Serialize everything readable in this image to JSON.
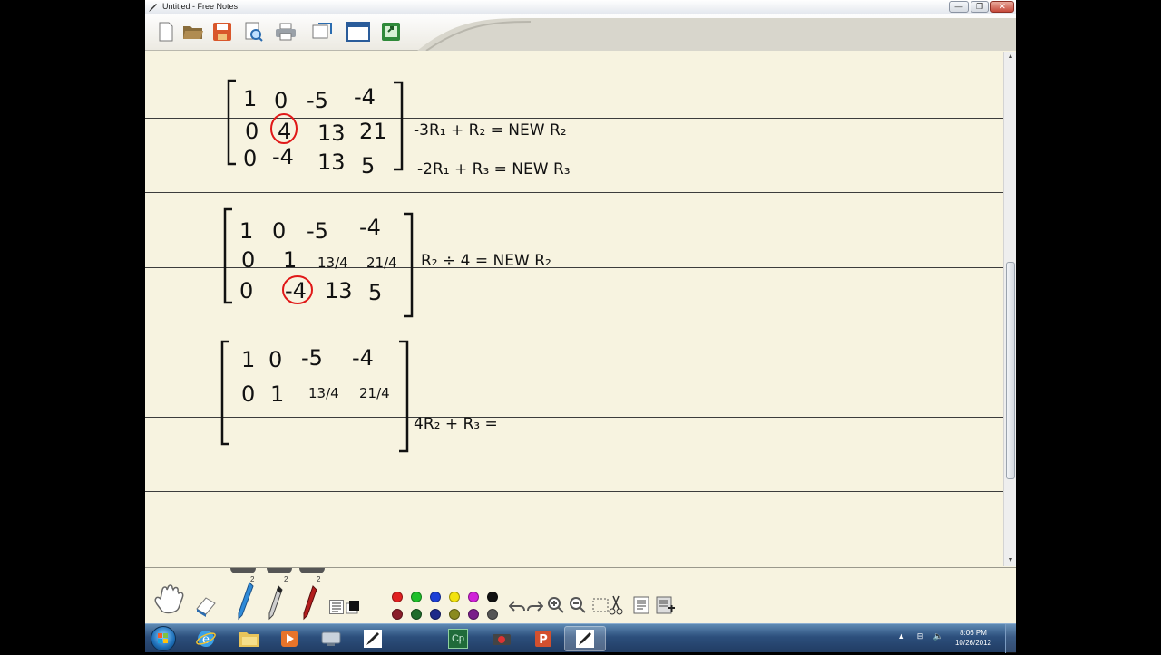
{
  "window": {
    "title": "Untitled - Free Notes",
    "minimize_glyph": "—",
    "restore_glyph": "❐",
    "close_glyph": "✕"
  },
  "toolbar": {
    "buttons": [
      {
        "name": "new-file-icon"
      },
      {
        "name": "open-folder-icon"
      },
      {
        "name": "save-icon"
      },
      {
        "name": "print-preview-icon"
      },
      {
        "name": "print-icon"
      },
      {
        "name": "scan-icon"
      },
      {
        "name": "window-icon"
      },
      {
        "name": "export-icon"
      }
    ]
  },
  "notes": {
    "matrix1": {
      "rows": [
        [
          "1",
          "0",
          "-5",
          "-4"
        ],
        [
          "0",
          "4",
          "13",
          "21"
        ],
        [
          "0",
          "-4",
          "13",
          "5"
        ]
      ],
      "op1": "-3R₁ + R₂ = NEW R₂",
      "op2": "-2R₁ + R₃ = NEW R₃"
    },
    "matrix2": {
      "rows": [
        [
          "1",
          "0",
          "-5",
          "-4"
        ],
        [
          "0",
          "1",
          "13/4",
          "21/4"
        ],
        [
          "0",
          "-4",
          "13",
          "5"
        ]
      ],
      "op1": "R₂ ÷ 4 = NEW R₂"
    },
    "matrix3": {
      "rows": [
        [
          "1",
          "0",
          "-5",
          "-4"
        ],
        [
          "0",
          "1",
          "13/4",
          "21/4"
        ]
      ],
      "op1": "4R₂ + R₃ ="
    }
  },
  "tray": {
    "tab_numbers": [
      "2",
      "2",
      "2"
    ],
    "pen_color_names": [
      "red",
      "green",
      "blue",
      "yellow",
      "magenta",
      "black"
    ],
    "pen_colors": [
      "#e02020",
      "#1fbf2a",
      "#1c3fd6",
      "#f2e20f",
      "#d020d8",
      "#111111"
    ],
    "marker_color_names": [
      "maroon",
      "dark-green",
      "dark-blue",
      "olive",
      "purple",
      "gray"
    ],
    "marker_colors": [
      "#8a1d2a",
      "#1e6b2a",
      "#1e2b8a",
      "#8a8a1e",
      "#7a1d8a",
      "#555555"
    ]
  },
  "taskbar": {
    "time": "8:06 PM",
    "date": "10/26/2012",
    "apps": [
      {
        "name": "internet-explorer-icon"
      },
      {
        "name": "file-explorer-icon"
      },
      {
        "name": "media-player-icon"
      },
      {
        "name": "network-icon"
      },
      {
        "name": "free-notes-icon"
      },
      {
        "name": "captivate-icon",
        "label": "Cp"
      },
      {
        "name": "recorder-icon"
      },
      {
        "name": "powerpoint-icon"
      },
      {
        "name": "free-notes-active-icon"
      }
    ]
  }
}
